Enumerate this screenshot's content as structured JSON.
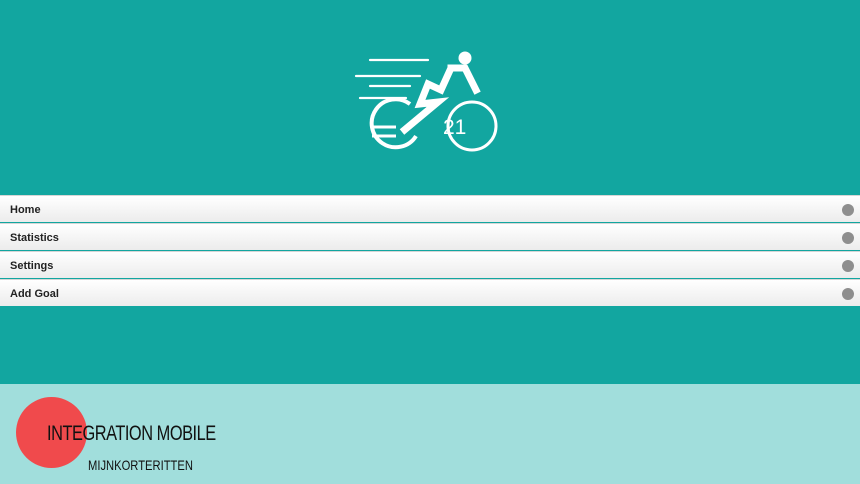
{
  "logo": {
    "icon": "cyclist-euro-icon",
    "number": "21"
  },
  "menu": {
    "items": [
      {
        "label": "Home",
        "icon": "circle-indicator-icon"
      },
      {
        "label": "Statistics",
        "icon": "circle-indicator-icon"
      },
      {
        "label": "Settings",
        "icon": "circle-indicator-icon"
      },
      {
        "label": "Add Goal",
        "icon": "circle-indicator-icon"
      }
    ]
  },
  "footer": {
    "title": "INTEGRATION MOBILE",
    "subtitle": "MIJNKORTERITTEN"
  },
  "colors": {
    "app_background": "#12a6a0",
    "footer_background": "#a1dedc",
    "accent_circle": "#f04a4c",
    "menu_dot": "#8e8e8e"
  }
}
